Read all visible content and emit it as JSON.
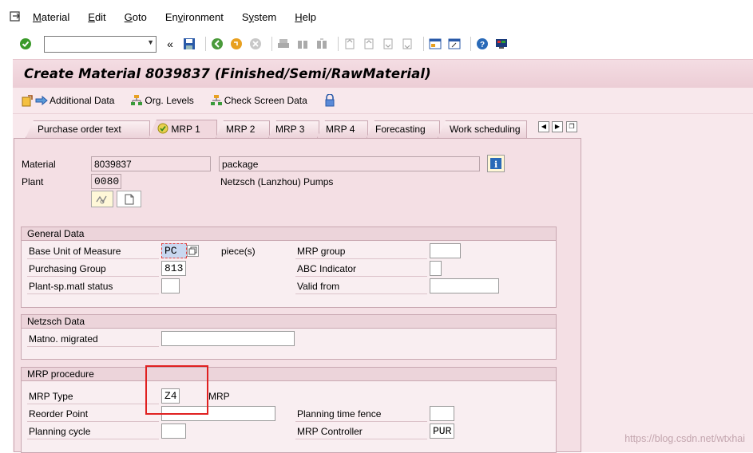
{
  "menubar": {
    "items": [
      "Material",
      "Edit",
      "Goto",
      "Environment",
      "System",
      "Help"
    ],
    "mnemonics": [
      "M",
      "E",
      "G",
      "v",
      "y",
      "H"
    ]
  },
  "toolbar": {
    "command_field_value": "",
    "nav_back_label": "«",
    "icons": [
      "enter-icon",
      "save-icon",
      "back-icon",
      "exit-icon",
      "cancel-icon",
      "print-icon",
      "find-icon",
      "find-next-icon",
      "first-page-icon",
      "prev-page-icon",
      "next-page-icon",
      "last-page-icon",
      "new-session-icon",
      "shortcut-icon",
      "help-icon",
      "customize-layout-icon"
    ]
  },
  "title": "Create Material 8039837 (Finished/Semi/RawMaterial)",
  "app_toolbar": {
    "additional_data": "Additional Data",
    "org_levels": "Org. Levels",
    "check_screen_data": "Check Screen Data"
  },
  "tabs": [
    {
      "label": "Purchase order text",
      "active": false
    },
    {
      "label": "MRP 1",
      "active": true
    },
    {
      "label": "MRP 2",
      "active": false
    },
    {
      "label": "MRP 3",
      "active": false
    },
    {
      "label": "MRP 4",
      "active": false
    },
    {
      "label": "Forecasting",
      "active": false
    },
    {
      "label": "Work scheduling",
      "active": false
    }
  ],
  "header": {
    "material_label": "Material",
    "material_value": "8039837",
    "material_desc": "package",
    "plant_label": "Plant",
    "plant_value": "0080",
    "plant_desc": "Netzsch (Lanzhou) Pumps"
  },
  "general_data": {
    "title": "General Data",
    "base_uom_label": "Base Unit of Measure",
    "base_uom_value": "PC",
    "base_uom_text": "piece(s)",
    "mrp_group_label": "MRP group",
    "mrp_group_value": "",
    "purch_group_label": "Purchasing Group",
    "purch_group_value": "813",
    "abc_label": "ABC Indicator",
    "abc_value": "",
    "plant_status_label": "Plant-sp.matl status",
    "plant_status_value": "",
    "valid_from_label": "Valid from",
    "valid_from_value": ""
  },
  "netzsch_data": {
    "title": "Netzsch Data",
    "matno_label": "Matno. migrated",
    "matno_value": ""
  },
  "mrp_procedure": {
    "title": "MRP procedure",
    "mrp_type_label": "MRP Type",
    "mrp_type_value": "Z4",
    "mrp_type_text": "MRP",
    "reorder_label": "Reorder Point",
    "reorder_value": "",
    "ptf_label": "Planning time fence",
    "ptf_value": "",
    "cycle_label": "Planning cycle",
    "cycle_value": "",
    "controller_label": "MRP Controller",
    "controller_value": "PUR"
  },
  "watermark": "https://blog.csdn.net/wtxhai",
  "colors": {
    "accent_bg": "#f4dfe4",
    "title_bg": "#eccdd5",
    "highlight": "#e02020"
  }
}
